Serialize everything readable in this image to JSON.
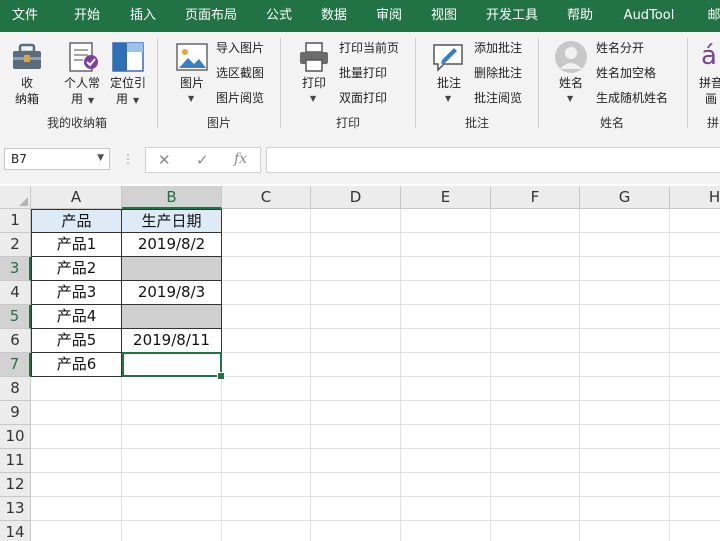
{
  "menu": {
    "tabs": [
      "文件",
      "开始",
      "插入",
      "页面布局",
      "公式",
      "数据",
      "审阅",
      "视图",
      "开发工具",
      "帮助",
      "AudTool",
      "邮"
    ]
  },
  "ribbon": {
    "groups": {
      "my_box": {
        "label": "我的收纳箱",
        "box_btn_line1": "收",
        "box_btn_line2": "纳箱",
        "personal_line1": "个人常",
        "personal_line2": "用",
        "locate_line1": "定位引",
        "locate_line2": "用"
      },
      "picture": {
        "label": "图片",
        "picture_btn": "图片",
        "import_picture": "导入图片",
        "select_screenshot": "选区截图",
        "picture_view": "图片阅览"
      },
      "print": {
        "label": "打印",
        "print_btn": "打印",
        "print_current": "打印当前页",
        "batch_print": "批量打印",
        "duplex_print": "双面打印"
      },
      "comment": {
        "label": "批注",
        "comment_btn": "批注",
        "add_comment": "添加批注",
        "delete_comment": "删除批注",
        "comment_view": "批注阅览"
      },
      "name": {
        "label": "姓名",
        "name_btn": "姓名",
        "split_name": "姓名分开",
        "add_space": "姓名加空格",
        "random_name": "生成随机姓名"
      },
      "pinyin": {
        "label": "拼",
        "btn_line1": "拼音",
        "btn_line2": "画",
        "glyph": "á"
      }
    }
  },
  "formula_bar": {
    "name_box": "B7",
    "cancel_symbol": "✕",
    "enter_symbol": "✓",
    "fx_symbol": "fx",
    "formula": ""
  },
  "sheet": {
    "columns": [
      "A",
      "B",
      "C",
      "D",
      "E",
      "F",
      "G",
      "H"
    ],
    "rows": [
      "1",
      "2",
      "3",
      "4",
      "5",
      "6",
      "7",
      "8",
      "9",
      "10",
      "11",
      "12",
      "13",
      "14"
    ],
    "selected_cell": "B7",
    "table": {
      "header": [
        "产品",
        "生产日期"
      ],
      "data": [
        [
          "产品1",
          "2019/8/2"
        ],
        [
          "产品2",
          ""
        ],
        [
          "产品3",
          "2019/8/3"
        ],
        [
          "产品4",
          ""
        ],
        [
          "产品5",
          "2019/8/11"
        ],
        [
          "产品6",
          ""
        ]
      ]
    }
  },
  "colors": {
    "brand": "#217346",
    "header_fill": "#ddebf7",
    "blank_fill": "#d0d0d0"
  }
}
